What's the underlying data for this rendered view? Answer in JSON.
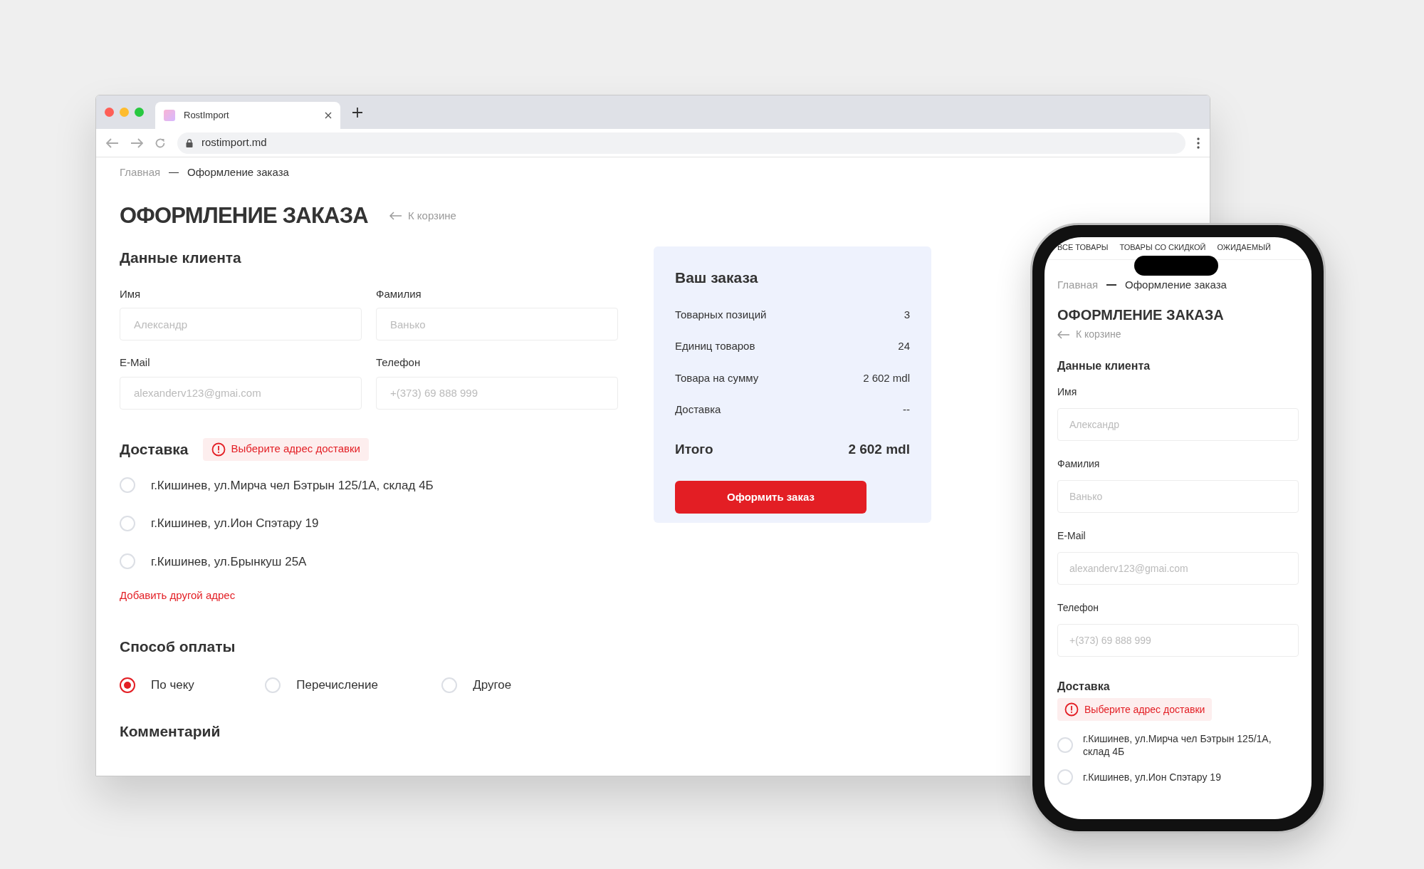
{
  "browser": {
    "tab_title": "RostImport",
    "url": "rostimport.md"
  },
  "desktop": {
    "breadcrumbs": [
      {
        "label": "Главная",
        "current": false
      },
      {
        "label": "Оформление заказа",
        "current": true
      }
    ],
    "title": "ОФОРМЛЕНИЕ ЗАКАЗА",
    "back_link": "К корзине",
    "client_section": "Данные клиента",
    "fields": [
      {
        "label": "Имя",
        "placeholder": "Александр"
      },
      {
        "label": "Фамилия",
        "placeholder": "Ванько"
      },
      {
        "label": "E-Mail",
        "placeholder": "alexanderv123@gmai.com"
      },
      {
        "label": "Телефон",
        "placeholder": "+(373) 69 888 999"
      }
    ],
    "delivery_section": "Доставка",
    "delivery_warning": "Выберите адрес доставки",
    "addresses": [
      {
        "label": "г.Кишинев, ул.Мирча чел Бэтрын 125/1А, склад 4Б",
        "selected": false
      },
      {
        "label": "г.Кишинев, ул.Ион Спэтару 19",
        "selected": false
      },
      {
        "label": "г.Кишинев, ул.Брынкуш 25А",
        "selected": false
      }
    ],
    "add_address": "Добавить другой адрес",
    "payment_section": "Способ оплаты",
    "payment_options": [
      {
        "label": "По чеку",
        "selected": true
      },
      {
        "label": "Перечисление",
        "selected": false
      },
      {
        "label": "Другое",
        "selected": false
      }
    ],
    "comment_section": "Комментарий",
    "summary": {
      "title": "Ваш заказа",
      "rows": [
        {
          "label": "Товарных позиций",
          "value": "3"
        },
        {
          "label": "Единиц товаров",
          "value": "24"
        },
        {
          "label": "Товара на сумму",
          "value": "2 602 mdl"
        },
        {
          "label": "Доставка",
          "value": "--"
        }
      ],
      "total_label": "Итого",
      "total_value": "2 602 mdl",
      "submit": "Оформить заказ"
    }
  },
  "phone": {
    "nav": [
      "ВСЕ ТОВАРЫ",
      "ТОВАРЫ СО СКИДКОЙ",
      "ОЖИДАЕМЫЙ"
    ],
    "breadcrumbs": [
      {
        "label": "Главная",
        "current": false
      },
      {
        "label": "Оформление заказа",
        "current": true
      }
    ],
    "title": "ОФОРМЛЕНИЕ ЗАКАЗА",
    "back_link": "К корзине",
    "client_section": "Данные клиента",
    "fields": [
      {
        "label": "Имя",
        "placeholder": "Александр"
      },
      {
        "label": "Фамилия",
        "placeholder": "Ванько"
      },
      {
        "label": "E-Mail",
        "placeholder": "alexanderv123@gmai.com"
      },
      {
        "label": "Телефон",
        "placeholder": "+(373) 69 888 999"
      }
    ],
    "delivery_section": "Доставка",
    "delivery_warning": "Выберите адрес доставки",
    "addresses": [
      {
        "label": "г.Кишинев, ул.Мирча чел Бэтрын 125/1А, склад 4Б",
        "selected": false
      },
      {
        "label": "г.Кишинев, ул.Ион Спэтару 19",
        "selected": false
      }
    ]
  }
}
